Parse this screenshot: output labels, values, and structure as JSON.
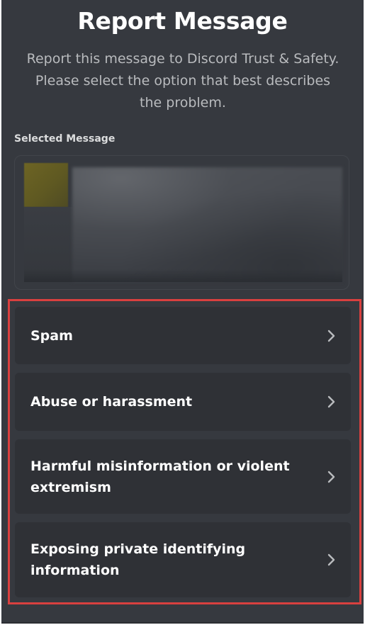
{
  "dialog": {
    "title": "Report Message",
    "subtitle": "Report this message to Discord Trust & Safety. Please select the option that best describes the problem.",
    "selected_message_label": "Selected Message"
  },
  "options": [
    {
      "label": "Spam",
      "icon": "chevron-right-icon"
    },
    {
      "label": "Abuse or harassment",
      "icon": "chevron-right-icon"
    },
    {
      "label": "Harmful misinformation or violent extremism",
      "icon": "chevron-right-icon"
    },
    {
      "label": "Exposing private identifying information",
      "icon": "chevron-right-icon"
    }
  ],
  "colors": {
    "background": "#36393f",
    "option_background": "#2f3136",
    "highlight_border": "#d9403f",
    "text_primary": "#ffffff",
    "text_secondary": "#b9bbbe"
  }
}
